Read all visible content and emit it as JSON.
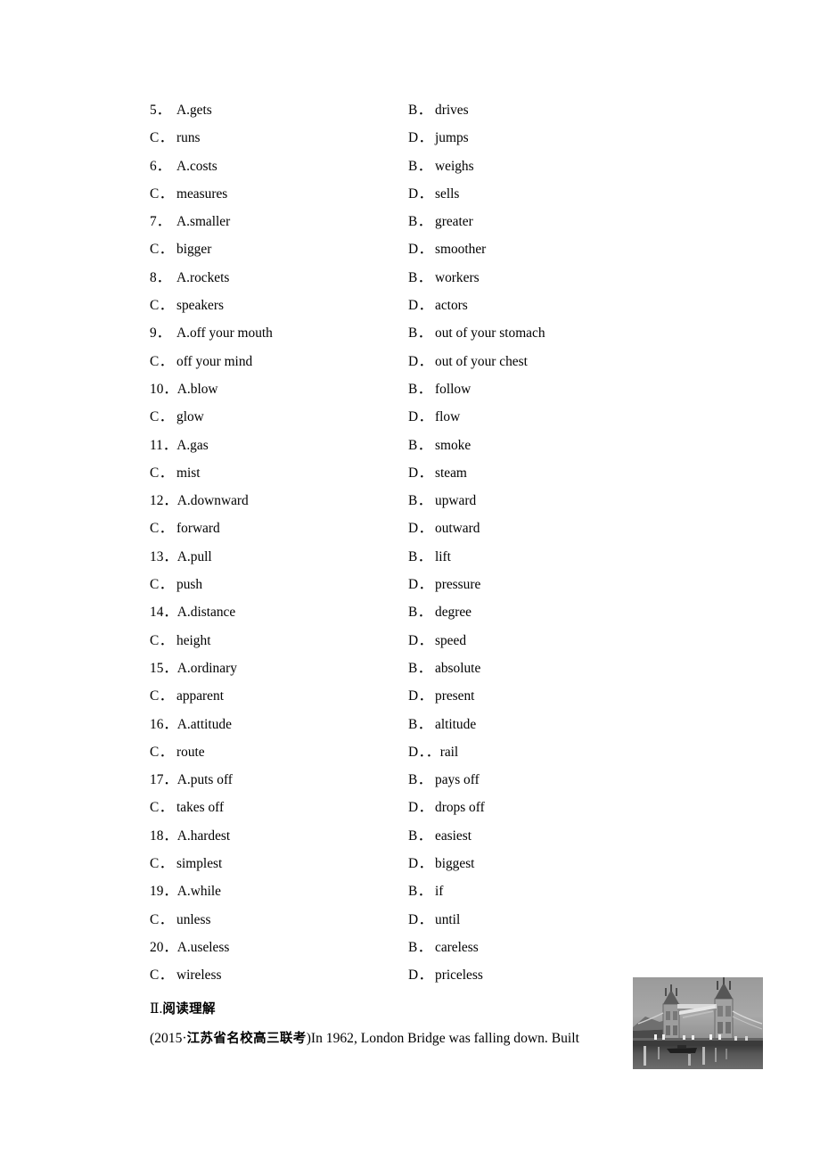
{
  "page": {
    "background": "#ffffff",
    "text_color": "#000000"
  },
  "cloze": {
    "option_labels": {
      "a": "A.",
      "b": "B．",
      "c": "C．",
      "d": "D．"
    },
    "questions": [
      {
        "number": "5．",
        "a": "A.gets",
        "b_label": "B．",
        "b": "drives",
        "c_label": "C．",
        "c": "runs",
        "d_label": "D．",
        "d": "jumps"
      },
      {
        "number": "6．",
        "a": "A.costs",
        "b_label": "B．",
        "b": "weighs",
        "c_label": "C．",
        "c": "measures",
        "d_label": "D．",
        "d": "sells"
      },
      {
        "number": "7．",
        "a": "A.smaller",
        "b_label": "B．",
        "b": "greater",
        "c_label": "C．",
        "c": "bigger",
        "d_label": "D．",
        "d": "smoother"
      },
      {
        "number": "8．",
        "a": "A.rockets",
        "b_label": "B．",
        "b": "workers",
        "c_label": "C．",
        "c": "speakers",
        "d_label": "D．",
        "d": "actors"
      },
      {
        "number": "9．",
        "a": "A.off your mouth",
        "b_label": "B．",
        "b": "out of your stomach",
        "c_label": "C．",
        "c": "off your mind",
        "d_label": "D．",
        "d": "out of your chest"
      },
      {
        "number": "10．",
        "a": "A.blow",
        "b_label": "B．",
        "b": "follow",
        "c_label": "C．",
        "c": "glow",
        "d_label": "D．",
        "d": "flow"
      },
      {
        "number": "11．",
        "a": "A.gas",
        "b_label": "B．",
        "b": "smoke",
        "c_label": "C．",
        "c": "mist",
        "d_label": "D．",
        "d": "steam"
      },
      {
        "number": "12．",
        "a": "A.downward",
        "b_label": "B．",
        "b": "upward",
        "c_label": "C．",
        "c": "forward",
        "d_label": "D．",
        "d": "outward"
      },
      {
        "number": "13．",
        "a": "A.pull",
        "b_label": "B．",
        "b": "lift",
        "c_label": "C．",
        "c": "push",
        "d_label": "D．",
        "d": "pressure"
      },
      {
        "number": "14．",
        "a": "A.distance",
        "b_label": "B．",
        "b": "degree",
        "c_label": "C．",
        "c": "height",
        "d_label": "D．",
        "d": "speed"
      },
      {
        "number": "15．",
        "a": "A.ordinary",
        "b_label": "B．",
        "b": "absolute",
        "c_label": "C．",
        "c": "apparent",
        "d_label": "D．",
        "d": "present"
      },
      {
        "number": "16．",
        "a": "A.attitude",
        "b_label": "B．",
        "b": "altitude",
        "c_label": "C．",
        "c": "route",
        "d_label": "D．．",
        "d": "rail"
      },
      {
        "number": "17．",
        "a": "A.puts off",
        "b_label": "B．",
        "b": "pays off",
        "c_label": "C．",
        "c": "takes off",
        "d_label": "D．",
        "d": "drops off"
      },
      {
        "number": "18．",
        "a": "A.hardest",
        "b_label": "B．",
        "b": "easiest",
        "c_label": "C．",
        "c": "simplest",
        "d_label": "D．",
        "d": "biggest"
      },
      {
        "number": "19．",
        "a": "A.while",
        "b_label": "B．",
        "b": "if",
        "c_label": "C．",
        "c": "unless",
        "d_label": "D．",
        "d": "until"
      },
      {
        "number": "20．",
        "a": "A.useless",
        "b_label": "B．",
        "b": "careless",
        "c_label": "C．",
        "c": "wireless",
        "d_label": "D．",
        "d": "priceless"
      }
    ]
  },
  "reading": {
    "heading_numeral": "Ⅱ",
    "heading_separator": ".",
    "heading_title": "阅读理解",
    "source_open": "(2015",
    "source_dot": "·",
    "source_cn": "江苏省名校高三联考",
    "source_close": ")",
    "passage_text": "In 1962, London Bridge was falling down. Built"
  },
  "figure": {
    "caption": "",
    "alt_name": "london-tower-bridge-photo",
    "tone_dark": "#3a3a3a",
    "tone_mid": "#8d8d8d",
    "tone_light": "#c9c9c9"
  }
}
